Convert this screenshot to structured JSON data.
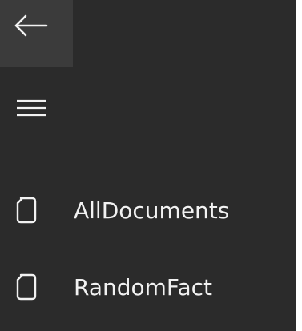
{
  "theme": {
    "background": "#2b2b2b",
    "back_button_bg": "#3b3b3b",
    "foreground": "#f2f2f2"
  },
  "back_button": {
    "icon": "back-arrow-icon"
  },
  "menu_button": {
    "icon": "hamburger-menu-icon"
  },
  "nav": {
    "items": [
      {
        "label": "AllDocuments",
        "icon": "document-icon"
      },
      {
        "label": "RandomFact",
        "icon": "document-icon"
      }
    ]
  }
}
